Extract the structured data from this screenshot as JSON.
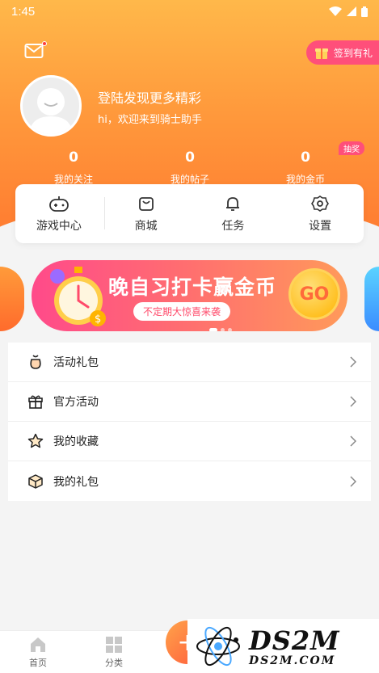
{
  "status_bar": {
    "time": "1:45"
  },
  "header": {
    "checkin_label": "签到有礼",
    "login_title": "登陆发现更多精彩",
    "login_subtitle": "hi，欢迎来到骑士助手",
    "lottery_badge": "抽奖"
  },
  "stats": [
    {
      "value": "0",
      "label": "我的关注"
    },
    {
      "value": "0",
      "label": "我的帖子"
    },
    {
      "value": "0",
      "label": "我的金币"
    }
  ],
  "quick_actions": [
    {
      "label": "游戏中心",
      "icon": "gamepad-icon"
    },
    {
      "label": "商城",
      "icon": "shopping-bag-icon"
    },
    {
      "label": "任务",
      "icon": "bell-icon"
    },
    {
      "label": "设置",
      "icon": "gear-icon"
    }
  ],
  "banner": {
    "title": "晚自习打卡赢金币",
    "subtitle": "不定期大惊喜来袭",
    "go_label": "GO",
    "page_count": 3,
    "active_page": 1
  },
  "menu": [
    {
      "label": "活动礼包",
      "icon": "gift-bag-icon"
    },
    {
      "label": "官方活动",
      "icon": "gift-box-icon"
    },
    {
      "label": "我的收藏",
      "icon": "star-icon"
    },
    {
      "label": "我的礼包",
      "icon": "package-icon"
    }
  ],
  "bottom_nav": [
    {
      "label": "首页",
      "icon": "home-icon"
    },
    {
      "label": "分类",
      "icon": "grid-icon"
    }
  ],
  "watermark": {
    "big": "DS2M",
    "small": "DS2M.COM"
  },
  "colors": {
    "accent": "#ff8a3a",
    "pink": "#ff4f7a"
  }
}
